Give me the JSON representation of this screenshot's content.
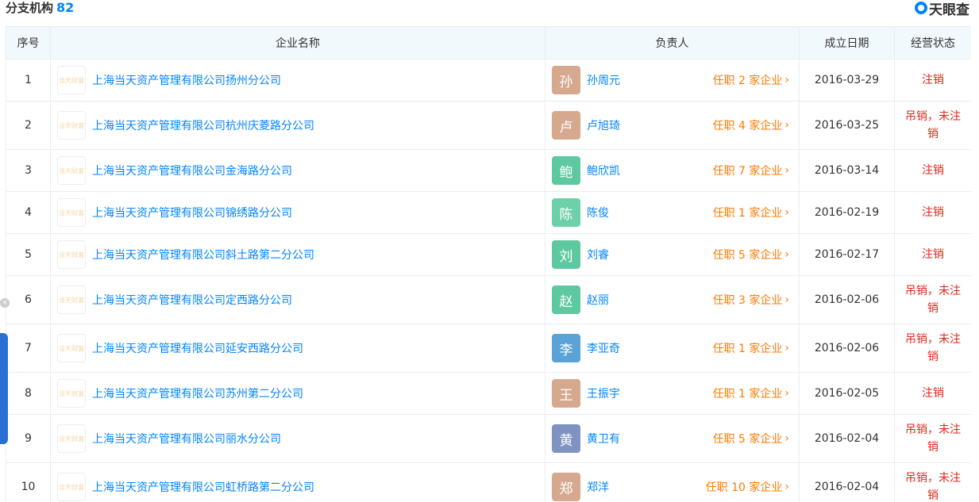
{
  "section": {
    "title": "分支机构",
    "count": "82"
  },
  "brand": {
    "name": "天眼查",
    "icon": "tianyancha-logo-icon"
  },
  "columns": [
    "序号",
    "企业名称",
    "负责人",
    "成立日期",
    "经营状态"
  ],
  "rows": [
    {
      "index": "1",
      "company": "上海当天资产管理有限公司扬州分公司",
      "logo_text": "当天财富",
      "person_initial": "孙",
      "person": "孙周元",
      "roles": "任职 2 家企业",
      "date": "2016-03-29",
      "status": "注销",
      "avatar_color": "#d6a98f",
      "height": 53
    },
    {
      "index": "2",
      "company": "上海当天资产管理有限公司杭州庆菱路分公司",
      "logo_text": "当天财富",
      "person_initial": "卢",
      "person": "卢旭琦",
      "roles": "任职 4 家企业",
      "date": "2016-03-25",
      "status": "吊销，未注销",
      "avatar_color": "#d6a98f",
      "height": 61
    },
    {
      "index": "3",
      "company": "上海当天资产管理有限公司金海路分公司",
      "logo_text": "当天财富",
      "person_initial": "鲍",
      "person": "鲍欣凯",
      "roles": "任职 7 家企业",
      "date": "2016-03-14",
      "status": "注销",
      "avatar_color": "#5ec9a0",
      "height": 53
    },
    {
      "index": "4",
      "company": "上海当天资产管理有限公司锦绣路分公司",
      "logo_text": "当天财富",
      "person_initial": "陈",
      "person": "陈俊",
      "roles": "任职 1 家企业",
      "date": "2016-02-19",
      "status": "注销",
      "avatar_color": "#6dd0a8",
      "height": 53
    },
    {
      "index": "5",
      "company": "上海当天资产管理有限公司斜土路第二分公司",
      "logo_text": "当天财富",
      "person_initial": "刘",
      "person": "刘睿",
      "roles": "任职 5 家企业",
      "date": "2016-02-17",
      "status": "注销",
      "avatar_color": "#5ec9a0",
      "height": 53
    },
    {
      "index": "6",
      "company": "上海当天资产管理有限公司定西路分公司",
      "logo_text": "当天财富",
      "person_initial": "赵",
      "person": "赵丽",
      "roles": "任职 3 家企业",
      "date": "2016-02-06",
      "status": "吊销，未注销",
      "avatar_color": "#5ec9a0",
      "height": 61
    },
    {
      "index": "7",
      "company": "上海当天资产管理有限公司延安西路分公司",
      "logo_text": "当天财富",
      "person_initial": "李",
      "person": "李亚奇",
      "roles": "任职 1 家企业",
      "date": "2016-02-06",
      "status": "吊销，未注销",
      "avatar_color": "#5ba3d6",
      "height": 61
    },
    {
      "index": "8",
      "company": "上海当天资产管理有限公司苏州第二分公司",
      "logo_text": "当天财富",
      "person_initial": "王",
      "person": "王振宇",
      "roles": "任职 1 家企业",
      "date": "2016-02-05",
      "status": "注销",
      "avatar_color": "#d6a98f",
      "height": 53
    },
    {
      "index": "9",
      "company": "上海当天资产管理有限公司丽水分公司",
      "logo_text": "当天财富",
      "person_initial": "黄",
      "person": "黄卫有",
      "roles": "任职 5 家企业",
      "date": "2016-02-04",
      "status": "吊销，未注销",
      "avatar_color": "#7f92c2",
      "height": 61
    },
    {
      "index": "10",
      "company": "上海当天资产管理有限公司虹桥路第二分公司",
      "logo_text": "当天财富",
      "person_initial": "郑",
      "person": "郑洋",
      "roles": "任职 10 家企业",
      "date": "2016-02-04",
      "status": "吊销，未注销",
      "avatar_color": "#d6a98f",
      "height": 61
    }
  ],
  "chevron_icon": "chevron-right-icon"
}
